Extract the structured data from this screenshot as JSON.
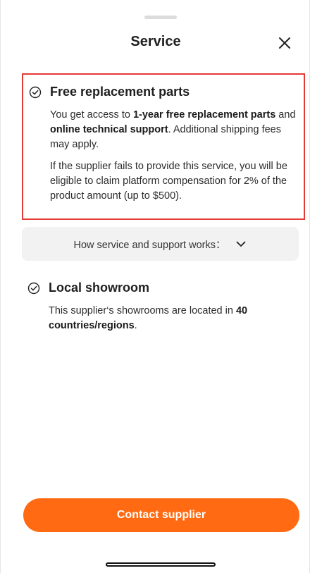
{
  "header": {
    "title": "Service",
    "close_icon": "close-icon"
  },
  "replacement": {
    "title": "Free replacement parts",
    "icon": "check-circle-icon",
    "p1_text1": "You get access to ",
    "p1_bold1": "1-year free replacement parts",
    "p1_text2": " and ",
    "p1_bold2": "online technical support",
    "p1_text3": ". Additional shipping fees may apply.",
    "p2": "If the supplier fails to provide this service, you will be eligible to claim platform compensation for 2% of the product amount (up to $500)."
  },
  "how_button": {
    "label": "How service and support works：",
    "icon": "chevron-down-icon"
  },
  "showroom": {
    "title": "Local showroom",
    "icon": "check-circle-icon",
    "text1": "This supplier‘s showrooms are located in ",
    "bold": "40 countries/regions",
    "text2": "."
  },
  "footer": {
    "contact_label": "Contact supplier"
  },
  "colors": {
    "accent": "#ff6a12",
    "highlight_border": "#e53935",
    "top_strip": "#2f86d6"
  }
}
